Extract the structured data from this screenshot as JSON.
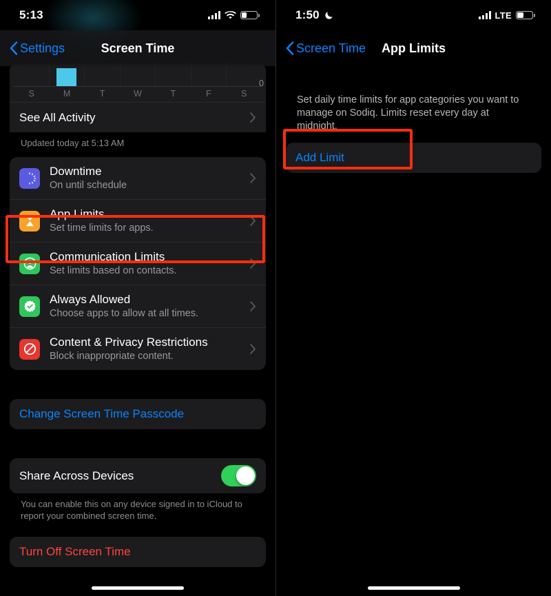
{
  "left": {
    "status": {
      "time": "5:13",
      "icons": [
        "cellular-bars-icon",
        "wifi-icon",
        "battery-icon"
      ],
      "battery_level_pct": 32
    },
    "nav": {
      "back_label": "Settings",
      "back_icon": "chevron-left-icon",
      "title": "Screen Time"
    },
    "chart": {
      "days": [
        "S",
        "M",
        "T",
        "W",
        "T",
        "F",
        "S"
      ],
      "axis_max_label": "0"
    },
    "see_all_activity": {
      "label": "See All Activity",
      "chevron": "chevron-right-icon"
    },
    "updated_note": "Updated today at 5:13 AM",
    "settings_rows": [
      {
        "title": "Downtime",
        "subtitle": "On until schedule",
        "icon": "downtime-icon",
        "icon_color": "#5a5ce0"
      },
      {
        "title": "App Limits",
        "subtitle": "Set time limits for apps.",
        "icon": "hourglass-icon",
        "icon_color": "#f7a32a"
      },
      {
        "title": "Communication Limits",
        "subtitle": "Set limits based on contacts.",
        "icon": "person-circle-icon",
        "icon_color": "#2fc65b"
      },
      {
        "title": "Always Allowed",
        "subtitle": "Choose apps to allow at all times.",
        "icon": "checkmark-seal-icon",
        "icon_color": "#2fc65b"
      },
      {
        "title": "Content & Privacy Restrictions",
        "subtitle": "Block inappropriate content.",
        "icon": "prohibited-icon",
        "icon_color": "#e8352e"
      }
    ],
    "change_passcode_label": "Change Screen Time Passcode",
    "share_across_devices": {
      "label": "Share Across Devices",
      "state": "on"
    },
    "share_footnote": "You can enable this on any device signed in to iCloud to report your combined screen time.",
    "turn_off_label": "Turn Off Screen Time"
  },
  "right": {
    "status": {
      "time": "1:50",
      "dnd_icon": "moon-icon",
      "carrier": "LTE",
      "icons": [
        "cellular-bars-icon",
        "battery-icon"
      ],
      "battery_level_pct": 42
    },
    "nav": {
      "back_label": "Screen Time",
      "back_icon": "chevron-left-icon",
      "title": "App Limits"
    },
    "description": "Set daily time limits for app categories you want to manage on Sodiq. Limits reset every day at midnight.",
    "add_limit_label": "Add Limit"
  },
  "highlight_color": "#ff2d10"
}
